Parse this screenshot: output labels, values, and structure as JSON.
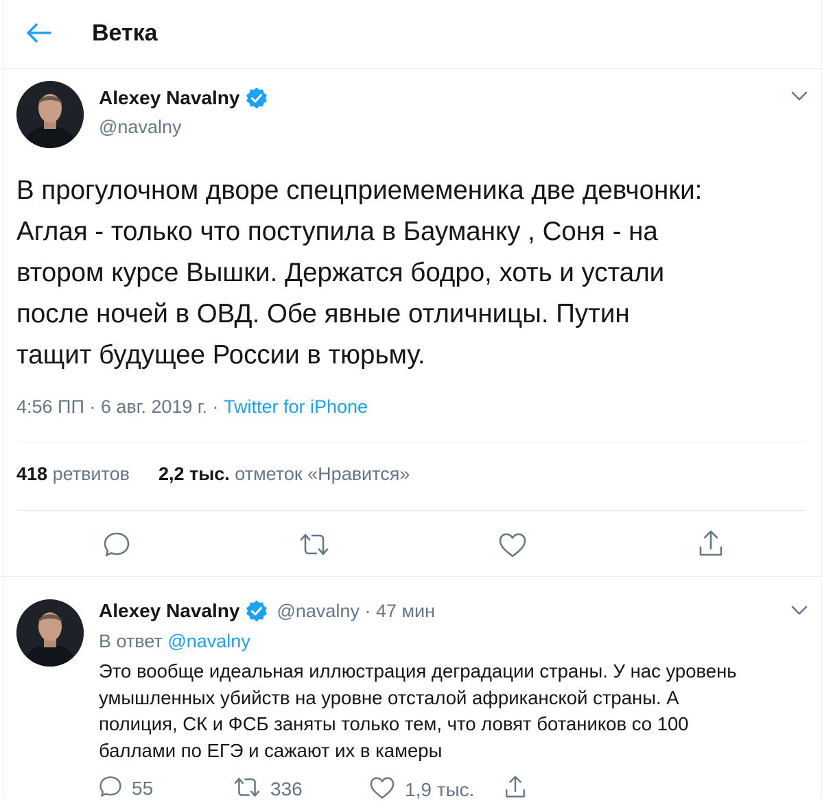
{
  "header": {
    "title": "Ветка"
  },
  "main_tweet": {
    "author": {
      "name": "Alexey Navalny",
      "handle": "@navalny"
    },
    "text": "В прогулочном дворе спецприемеменика две девчонки:\nАглая - только что поступила в Бауманку , Соня - на\nвтором курсе Вышки. Держатся бодро, хоть и устали\nпосле ночей в ОВД. Обе явные отличницы. Путин\nтащит будущее России в тюрьму.",
    "time": "4:56 ПП",
    "date": "6 авг. 2019 г.",
    "source": "Twitter for iPhone",
    "retweets_count": "418",
    "retweets_label": "ретвитов",
    "likes_count": "2,2 тыс.",
    "likes_label": "отметок «Нравится»"
  },
  "reply_tweet": {
    "author": {
      "name": "Alexey Navalny",
      "handle": "@navalny"
    },
    "time_ago": "47 мин",
    "reply_prefix": "В ответ",
    "reply_mention": "@navalny",
    "text": "Это вообще идеальная иллюстрация деградации страны. У нас уровень\nумышленных убийств на уровне отсталой африканской страны. А\nполиция, СК и ФСБ заняты только тем, что ловят ботаников со 100\nбаллами по ЕГЭ и сажают их в камеры",
    "replies": "55",
    "retweets": "336",
    "likes": "1,9 тыс."
  },
  "icons": {
    "back": "arrow-left-icon",
    "verified": "verified-badge-icon",
    "chevron": "chevron-down-icon",
    "reply": "reply-icon",
    "retweet": "retweet-icon",
    "like": "heart-icon",
    "share": "share-icon"
  },
  "colors": {
    "accent": "#1da1f2",
    "text": "#14171a",
    "muted": "#657786",
    "border": "#e6ecf0"
  }
}
